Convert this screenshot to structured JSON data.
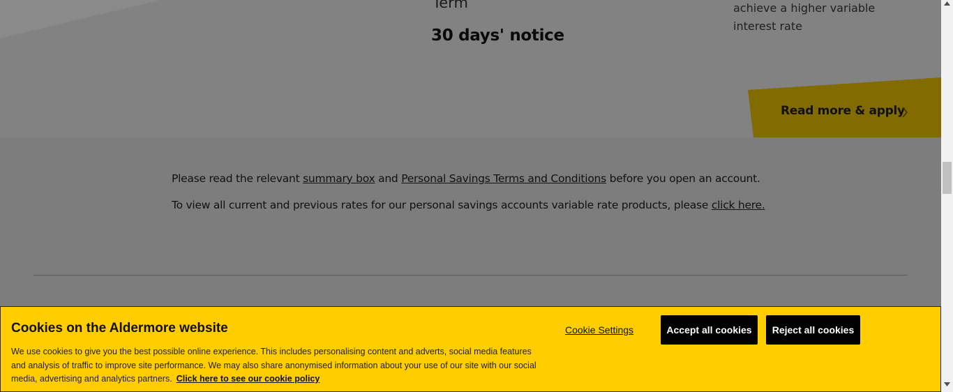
{
  "product_card": {
    "term_label": "Term",
    "notice_value": "30 days' notice",
    "rate_note": "achieve a higher variable interest rate",
    "apply_label": "Read more & apply",
    "icons": {
      "apply": "chevron-right-icon"
    }
  },
  "info": {
    "line1_prefix": "Please read the relevant ",
    "summary_link": "summary box",
    "line1_and": " and ",
    "terms_link": "Personal Savings Terms and Conditions",
    "line1_suffix": " before you open an account.",
    "line2_prefix": "To view all current and previous rates for our personal savings accounts variable rate products, please ",
    "click_here_link": "click here."
  },
  "cookie_banner": {
    "title": "Cookies on the Aldermore website",
    "text": "We use cookies to give you the best possible online experience. This includes personalising content and adverts, social media features and analysis of traffic to improve site performance. We may also share anonymised information about your use of our site with our social media, advertising and analytics partners.",
    "policy_link": "Click here to see our cookie policy",
    "settings_label": "Cookie Settings",
    "accept_label": "Accept all cookies",
    "reject_label": "Reject all cookies"
  },
  "colors": {
    "brand_yellow": "#ffcd00",
    "overlay_gray": "#7d7d7d",
    "button_black": "#000000"
  }
}
